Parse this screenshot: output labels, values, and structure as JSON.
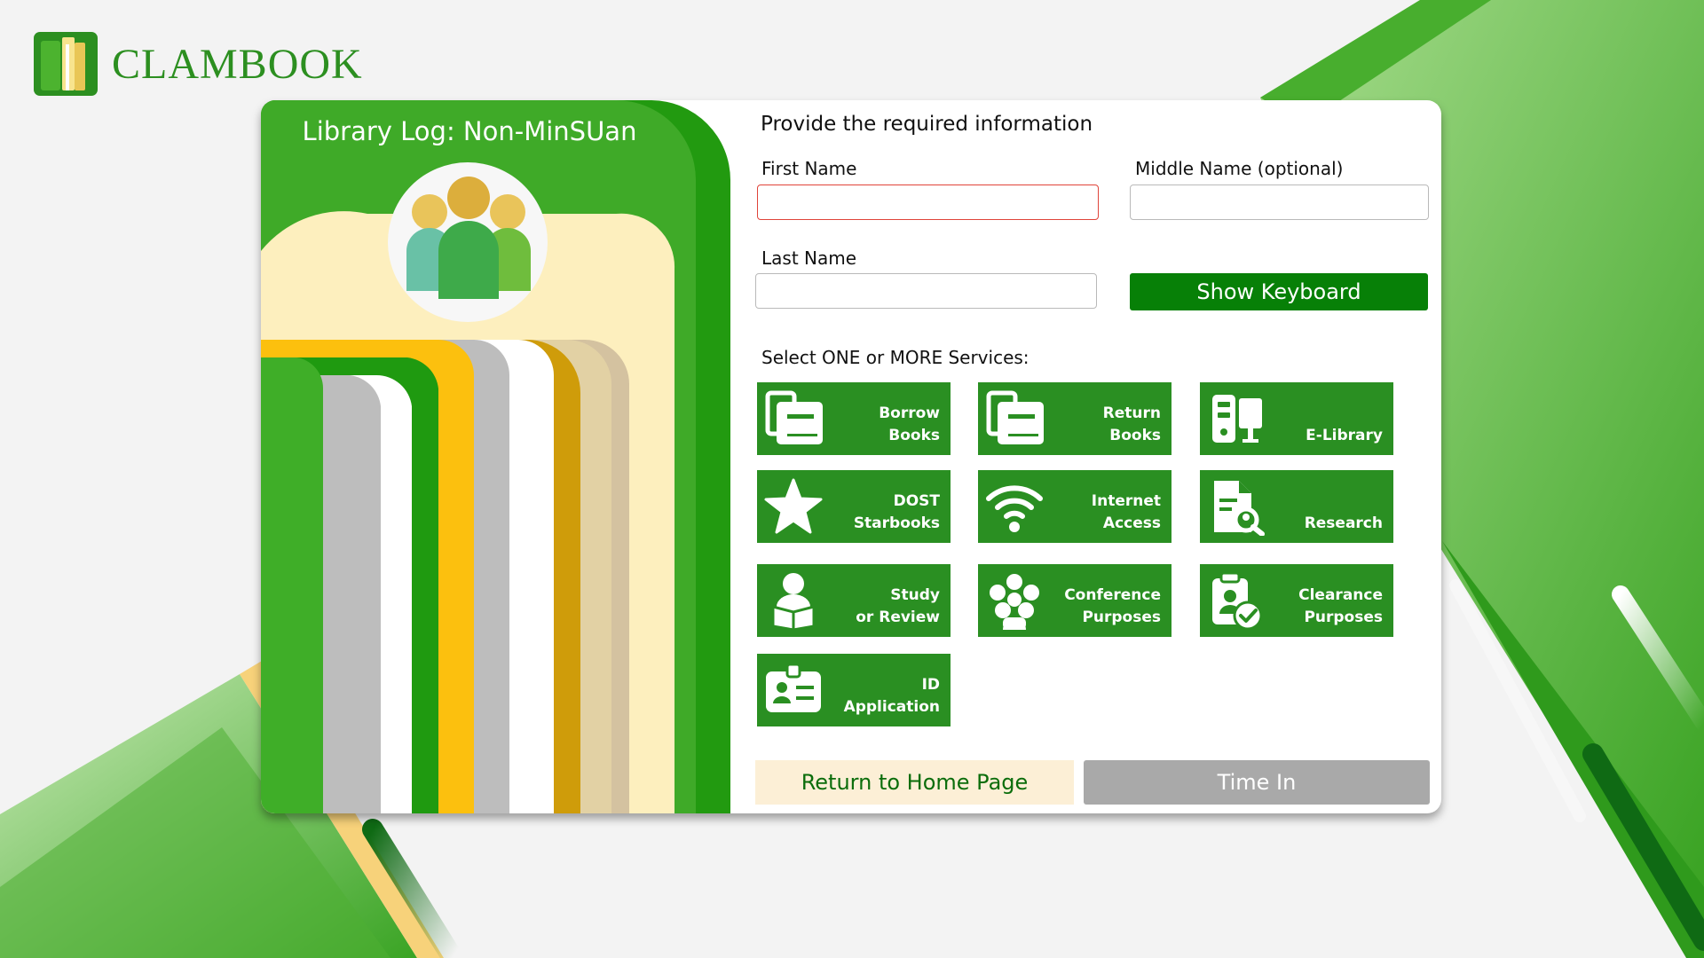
{
  "brand": {
    "name": "CLAMBOOK"
  },
  "panel": {
    "title": "Library Log: Non-MinSUan"
  },
  "form": {
    "heading": "Provide the required information",
    "first_name": {
      "label": "First Name",
      "value": "",
      "placeholder": ""
    },
    "middle_name": {
      "label": "Middle Name (optional)",
      "value": "",
      "placeholder": ""
    },
    "last_name": {
      "label": "Last Name",
      "value": "",
      "placeholder": ""
    },
    "keyboard_button": "Show Keyboard"
  },
  "services": {
    "label": "Select ONE or MORE Services:",
    "items": [
      {
        "line1": "Borrow",
        "line2": "Books",
        "icon": "books-icon"
      },
      {
        "line1": "Return",
        "line2": "Books",
        "icon": "books-icon"
      },
      {
        "line1": "",
        "line2": "E-Library",
        "icon": "computer-icon"
      },
      {
        "line1": "DOST",
        "line2": "Starbooks",
        "icon": "star-icon"
      },
      {
        "line1": "Internet",
        "line2": "Access",
        "icon": "wifi-icon"
      },
      {
        "line1": "",
        "line2": "Research",
        "icon": "document-search-icon"
      },
      {
        "line1": "Study",
        "line2": "or Review",
        "icon": "reader-icon"
      },
      {
        "line1": "Conference",
        "line2": "Purposes",
        "icon": "group-icon"
      },
      {
        "line1": "Clearance",
        "line2": "Purposes",
        "icon": "clipboard-check-icon"
      },
      {
        "line1": "ID",
        "line2": "Application",
        "icon": "id-card-icon"
      }
    ]
  },
  "actions": {
    "home": "Return to Home Page",
    "time_in": "Time In"
  },
  "colors": {
    "primary_green": "#2a8f22",
    "dark_green_button": "#078007",
    "error_border": "#e0443a",
    "cream": "#fcefd6",
    "disabled_gray": "#a9a9a9"
  }
}
